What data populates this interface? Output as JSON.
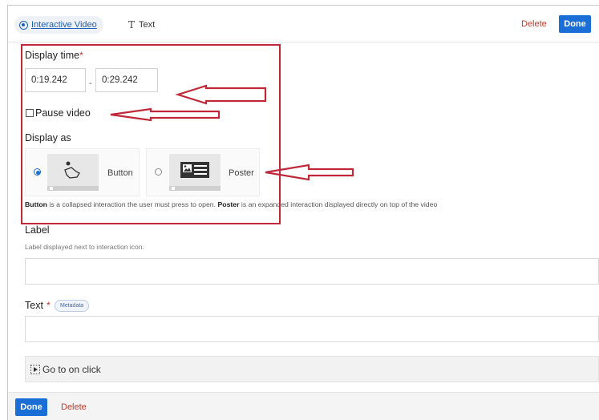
{
  "header": {
    "tab_active_label": "Interactive Video",
    "tab_text_label": "Text",
    "delete_label": "Delete",
    "done_label": "Done"
  },
  "display_time": {
    "label": "Display time",
    "required_mark": "*",
    "start_value": "0:19.242",
    "separator": "-",
    "end_value": "0:29.242"
  },
  "pause": {
    "label": "Pause video",
    "checked": false
  },
  "display_as": {
    "label": "Display as",
    "options": [
      {
        "label": "Button",
        "selected": true
      },
      {
        "label": "Poster",
        "selected": false
      }
    ],
    "help_button": "Button",
    "help_mid": " is a collapsed interaction the user must press to open. ",
    "help_poster": "Poster",
    "help_end": " is an expanded interaction displayed directly on top of the video"
  },
  "label_field": {
    "title": "Label",
    "description": "Label displayed next to interaction icon.",
    "value": ""
  },
  "text_field": {
    "title": "Text",
    "required_mark": "*",
    "metadata_label": "Metadata",
    "value": ""
  },
  "goto": {
    "label": "Go to on click"
  },
  "footer": {
    "done_label": "Done",
    "delete_label": "Delete"
  },
  "colors": {
    "accent": "#1a6ed6",
    "delete": "#c0392b",
    "annotation": "#c0283a"
  }
}
